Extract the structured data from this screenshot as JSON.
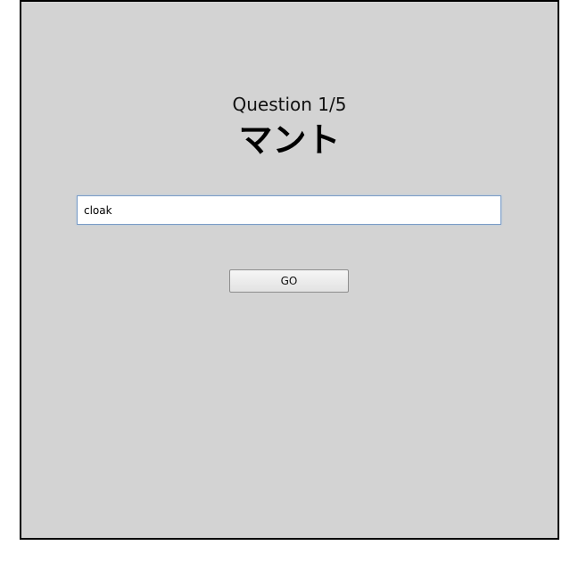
{
  "quiz": {
    "question_counter": "Question 1/5",
    "word": "マント",
    "answer_value": "cloak",
    "go_label": "GO"
  },
  "colors": {
    "panel_background": "#d3d3d3",
    "panel_border": "#000000",
    "input_border": "#7a9cc6"
  }
}
